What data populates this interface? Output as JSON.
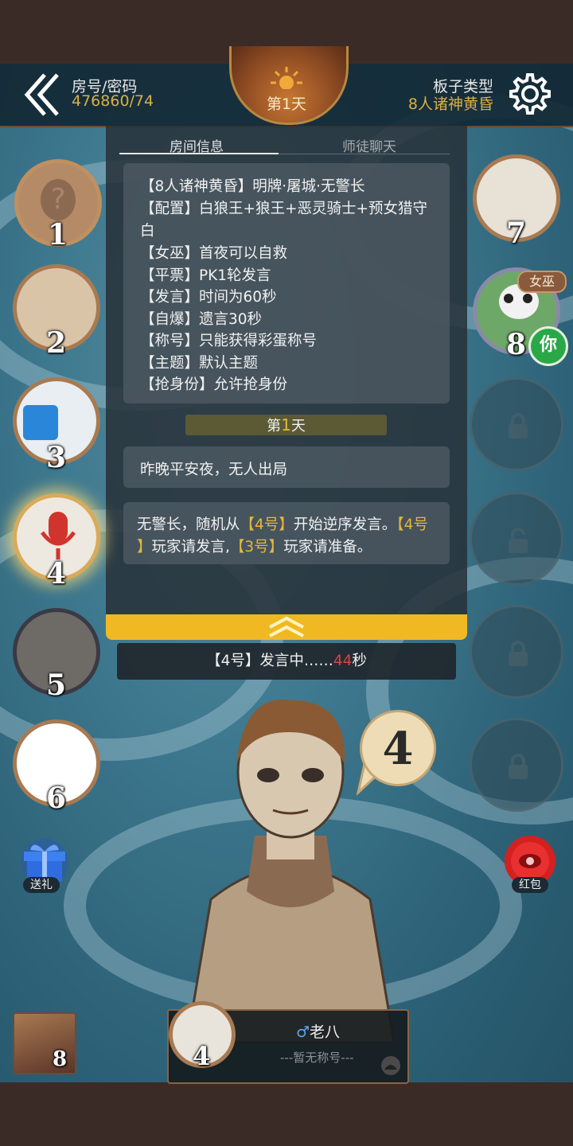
{
  "header": {
    "room_label": "房号/密码",
    "room_value": "476860/74",
    "day_label": "第1天",
    "board_label": "板子类型",
    "board_value": "8人诸神黄昏"
  },
  "tabs": [
    {
      "label": "房间信息",
      "active": true
    },
    {
      "label": "师徒聊天",
      "active": false
    }
  ],
  "room_info": [
    "【8人诸神黄昏】明牌·屠城·无警长",
    "【配置】白狼王+狼王+恶灵骑士+预女猎守",
    "白",
    "【女巫】首夜可以自救",
    "【平票】PK1轮发言",
    "【发言】时间为60秒",
    "【自爆】遗言30秒",
    "【称号】只能获得彩蛋称号",
    "【主题】默认主题",
    "【抢身份】允许抢身份"
  ],
  "day_divider": {
    "prefix": "第",
    "num": "1",
    "suffix": "天"
  },
  "messages": {
    "night_result": "昨晚平安夜，无人出局",
    "order_line1_a": "无警长，随机从",
    "order_line1_b": "【4号】",
    "order_line1_c": "开始逆序发言。",
    "order_line1_d": "【4号",
    "order_line2_a": "】",
    "order_line2_b": "玩家请发言,",
    "order_line2_c": "【3号】",
    "order_line2_d": "玩家请准备。"
  },
  "speaking": {
    "prefix": "【4号】发言中……",
    "seconds": "44",
    "suffix": "秒"
  },
  "seats": {
    "s1": "1",
    "s2": "2",
    "s3": "3",
    "s4": "4",
    "s5": "5",
    "s6": "6",
    "s7": "7",
    "s8": "8"
  },
  "role_badge": "女巫",
  "you_badge": "你",
  "bubble_number": "4",
  "gift_label": "送礼",
  "redpack_label": "红包",
  "player": {
    "gender": "♂",
    "name": "老八",
    "title": "---暂无称号---",
    "seat": "4"
  },
  "my_seat": "8",
  "colors": {
    "accent": "#d7b045",
    "highlight": "#e3b93b",
    "timer": "#e04040",
    "you": "#2aa848"
  }
}
